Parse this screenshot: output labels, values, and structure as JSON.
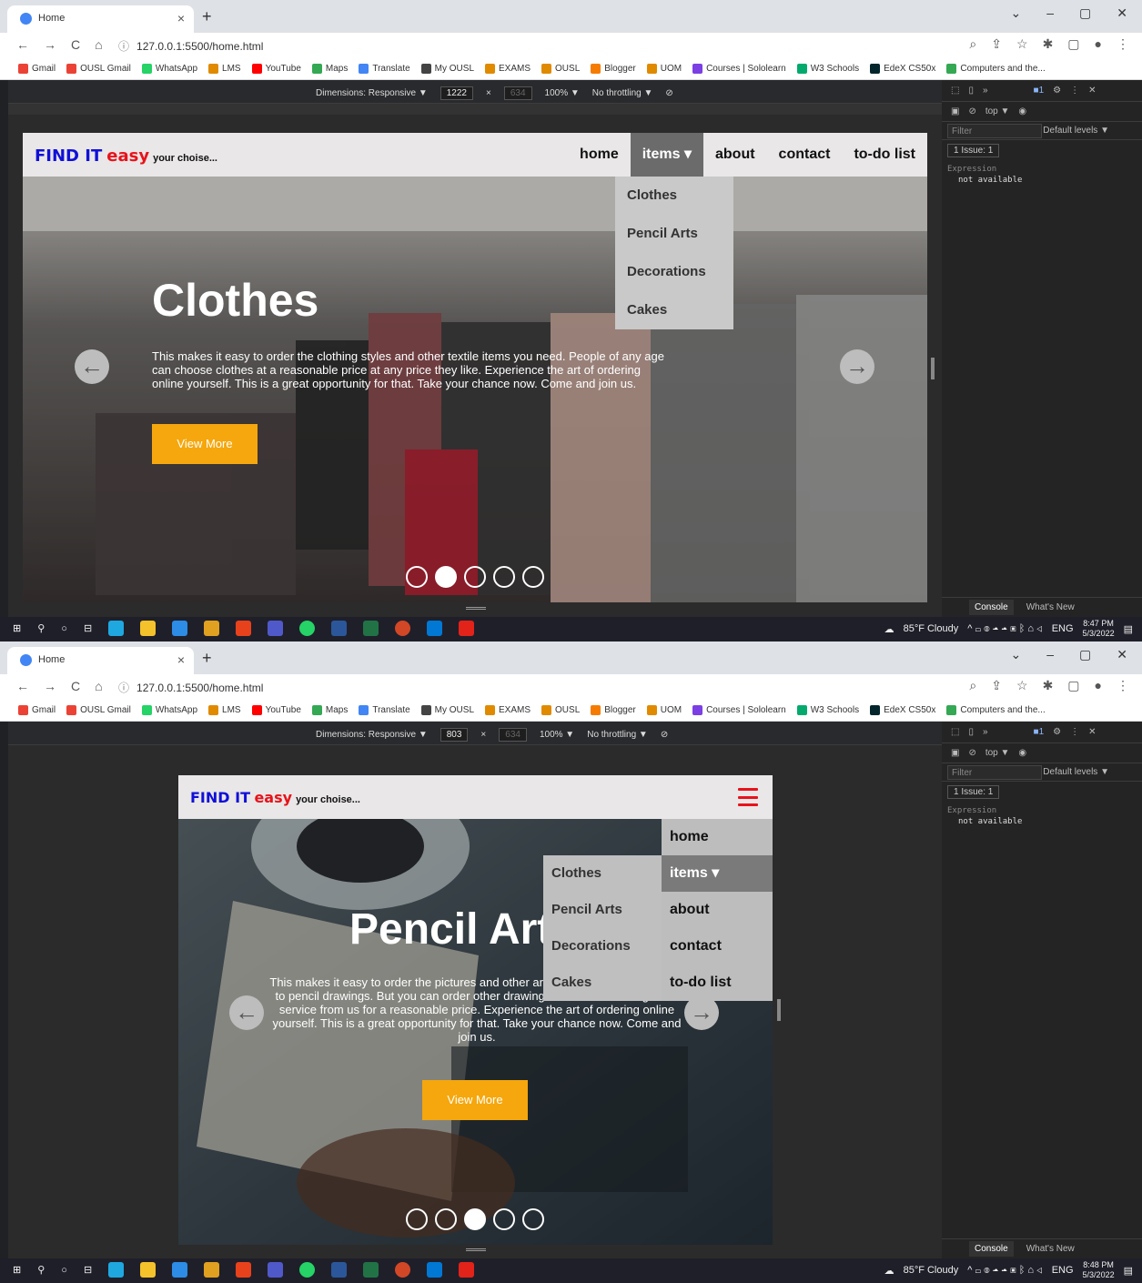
{
  "browser": {
    "tab_title": "Home",
    "url": "127.0.0.1:5500/home.html",
    "bookmarks": [
      "Gmail",
      "OUSL Gmail",
      "WhatsApp",
      "LMS",
      "YouTube",
      "Maps",
      "Translate",
      "My OUSL",
      "EXAMS",
      "OUSL",
      "Blogger",
      "UOM",
      "Courses | Sololearn",
      "W3 Schools",
      "EdeX CS50x",
      "Computers and the..."
    ]
  },
  "devtools": {
    "dimensions_label": "Dimensions: Responsive ▼",
    "zoom": "100% ▼",
    "throttle": "No throttling ▼",
    "height": "634",
    "top": "top ▼",
    "filter": "Filter",
    "levels": "Default levels ▼",
    "issue": "1 Issue: 1",
    "expression": "Expression",
    "not_available": "not available",
    "console": "Console",
    "whats_new": "What's New"
  },
  "site": {
    "logo_a": "FIND IT",
    "logo_b": "easy",
    "logo_c": "your choise...",
    "menu": [
      "home",
      "items ▾",
      "about",
      "contact",
      "to-do list"
    ],
    "dropdown": [
      "Clothes",
      "Pencil Arts",
      "Decorations",
      "Cakes"
    ],
    "view_more": "View More"
  },
  "shot1": {
    "width": "1222",
    "title": "Clothes",
    "text": "This makes it easy to order the clothing styles and other textile items you need. People of any age can choose clothes at a reasonable price at any price they like. Experience the art of ordering online yourself. This is a great opportunity for that. Take your chance now. Come and join us.",
    "time": "8:47 PM",
    "date": "5/3/2022",
    "active_dot": 1
  },
  "shot2": {
    "width": "803",
    "title": "Pencil Arts",
    "text": "This makes it easy to order the pictures and other art you want. Priority is given to pencil drawings. But you can order other drawings as well. You can get the service from us for a reasonable price. Experience the art of ordering online yourself. This is a great opportunity for that. Take your chance now. Come and join us.",
    "time": "8:48 PM",
    "date": "5/3/2022",
    "active_dot": 2
  },
  "taskbar": {
    "weather": "85°F Cloudy",
    "lang": "ENG"
  },
  "colors": {
    "brand_blue": "#1010d8",
    "brand_red": "#e8121b",
    "button": "#f5a70d",
    "nav_bg": "#e9e7e7"
  }
}
